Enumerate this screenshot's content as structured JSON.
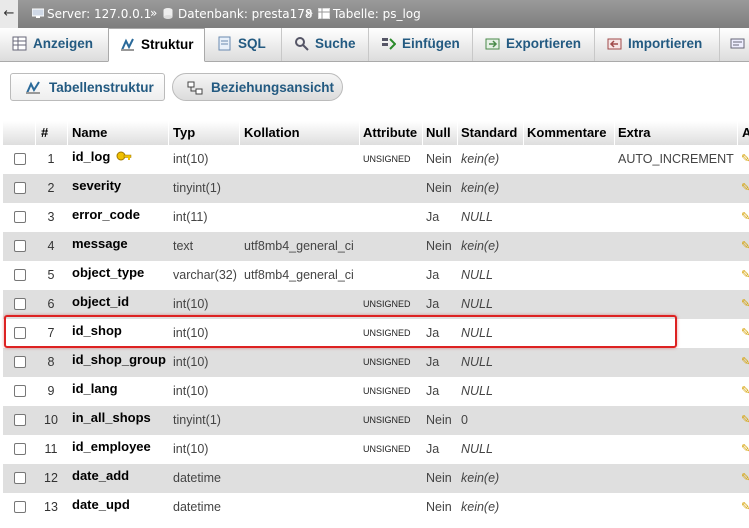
{
  "breadcrumb": {
    "server": "Server: 127.0.0.1",
    "database": "Datenbank: presta178",
    "table": "Tabelle: ps_log",
    "separator": "»"
  },
  "tabs": [
    {
      "label": "Anzeigen",
      "icon": "table-icon"
    },
    {
      "label": "Struktur",
      "icon": "structure-icon",
      "active": true
    },
    {
      "label": "SQL",
      "icon": "sql-icon"
    },
    {
      "label": "Suche",
      "icon": "search-icon"
    },
    {
      "label": "Einfügen",
      "icon": "insert-icon"
    },
    {
      "label": "Exportieren",
      "icon": "export-icon"
    },
    {
      "label": "Importieren",
      "icon": "import-icon"
    }
  ],
  "views": {
    "structure_label": "Tabellenstruktur",
    "relation_label": "Beziehungsansicht"
  },
  "table": {
    "headers": {
      "num": "#",
      "name": "Name",
      "type": "Typ",
      "collation": "Kollation",
      "attributes": "Attribute",
      "null": "Null",
      "default": "Standard",
      "comments": "Kommentare",
      "extra": "Extra",
      "action": "A"
    },
    "rows": [
      {
        "num": "1",
        "name": "id_log",
        "type": "int(10)",
        "collation": "",
        "attr": "UNSIGNED",
        "null": "Nein",
        "default": "kein(e)",
        "extra": "AUTO_INCREMENT",
        "primary": true
      },
      {
        "num": "2",
        "name": "severity",
        "type": "tinyint(1)",
        "collation": "",
        "attr": "",
        "null": "Nein",
        "default": "kein(e)",
        "extra": ""
      },
      {
        "num": "3",
        "name": "error_code",
        "type": "int(11)",
        "collation": "",
        "attr": "",
        "null": "Ja",
        "default": "NULL",
        "extra": ""
      },
      {
        "num": "4",
        "name": "message",
        "type": "text",
        "collation": "utf8mb4_general_ci",
        "attr": "",
        "null": "Nein",
        "default": "kein(e)",
        "extra": ""
      },
      {
        "num": "5",
        "name": "object_type",
        "type": "varchar(32)",
        "collation": "utf8mb4_general_ci",
        "attr": "",
        "null": "Ja",
        "default": "NULL",
        "extra": ""
      },
      {
        "num": "6",
        "name": "object_id",
        "type": "int(10)",
        "collation": "",
        "attr": "UNSIGNED",
        "null": "Ja",
        "default": "NULL",
        "extra": ""
      },
      {
        "num": "7",
        "name": "id_shop",
        "type": "int(10)",
        "collation": "",
        "attr": "UNSIGNED",
        "null": "Ja",
        "default": "NULL",
        "extra": "",
        "highlighted": true
      },
      {
        "num": "8",
        "name": "id_shop_group",
        "type": "int(10)",
        "collation": "",
        "attr": "UNSIGNED",
        "null": "Ja",
        "default": "NULL",
        "extra": ""
      },
      {
        "num": "9",
        "name": "id_lang",
        "type": "int(10)",
        "collation": "",
        "attr": "UNSIGNED",
        "null": "Ja",
        "default": "NULL",
        "extra": ""
      },
      {
        "num": "10",
        "name": "in_all_shops",
        "type": "tinyint(1)",
        "collation": "",
        "attr": "UNSIGNED",
        "null": "Nein",
        "default": "0",
        "extra": ""
      },
      {
        "num": "11",
        "name": "id_employee",
        "type": "int(10)",
        "collation": "",
        "attr": "UNSIGNED",
        "null": "Ja",
        "default": "NULL",
        "extra": ""
      },
      {
        "num": "12",
        "name": "date_add",
        "type": "datetime",
        "collation": "",
        "attr": "",
        "null": "Nein",
        "default": "kein(e)",
        "extra": ""
      },
      {
        "num": "13",
        "name": "date_upd",
        "type": "datetime",
        "collation": "",
        "attr": "",
        "null": "Nein",
        "default": "kein(e)",
        "extra": ""
      }
    ]
  },
  "colors": {
    "link": "#235a81",
    "highlight": "#dd2222",
    "key": "#d4a000"
  }
}
